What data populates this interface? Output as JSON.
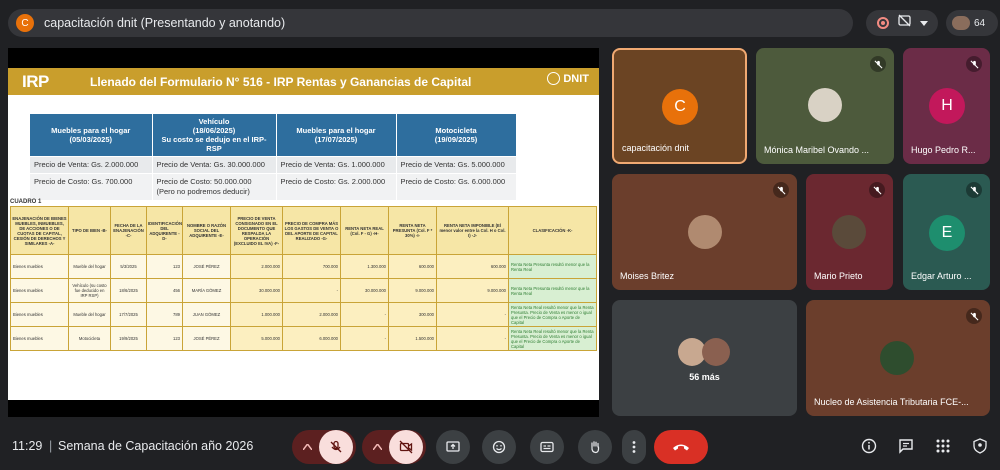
{
  "meeting": {
    "title_initial": "C",
    "title": "capacitación dnit (Presentando y anotando)",
    "participant_count": "64"
  },
  "slide": {
    "logo_text": "IRP",
    "title": "Llenado del Formulario N° 516 - IRP Rentas y Ganancias de Capital",
    "brand": "DNIT",
    "top_table": {
      "headers": [
        "Muebles para el hogar\n(05/03/2025)",
        "Vehículo\n(18/06/2025)\nSu costo se dedujo en el IRP-RSP",
        "Muebles para el hogar\n(17/07/2025)",
        "Motocicleta\n(19/09/2025)"
      ],
      "sale_row": [
        "Precio de Venta: Gs. 2.000.000",
        "Precio de Venta: Gs. 30.000.000",
        "Precio de Venta: Gs. 1.000.000",
        "Precio de Venta: Gs. 5.000.000"
      ],
      "cost_row": [
        "Precio de Costo: Gs. 700.000",
        "Precio de Costo: 50.000.000 (Pero no podremos deducir)",
        "Precio de Costo: Gs. 2.000.000",
        "Precio de Costo: Gs. 6.000.000"
      ]
    },
    "cuadro_label": "CUADRO 1",
    "main_table": {
      "headers": [
        "ENAJENACIÓN DE BIENES MUEBLES, INMUEBLES, DE ACCIONES O DE CUOTAS DE CAPITAL, CESIÓN DE DERECHOS Y SIMILARES -A-",
        "TIPO DE BIEN -B-",
        "FECHA DE LA ENAJENACIÓN -C-",
        "IDENTIFICACIÓN DEL ADQUIRENTE -D-",
        "NOMBRE O RAZÓN SOCIAL DEL ADQUIRENTE -E-",
        "PRECIO DE VENTA CONSIGNADO EN EL DOCUMENTO QUE RESPALDA LA OPERACIÓN (EXCLUIDO EL IVA) -F-",
        "PRECIO DE COMPRA MÁS LOS GASTOS DE VENTA O DEL APORTE DE CAPITAL REALIZADO -G-",
        "RENTA NETA REAL (Col. F - G) -H-",
        "RENTA NETA PRESUNTA (Col. F * 30%) -I-",
        "RENTA NETA IMPONIBLE (El menor valor entre la Col. H o Col. I) -J-",
        "CLASIFICACIÓN -K-"
      ],
      "rows": [
        [
          "Bienes muebles",
          "Mueble del hogar",
          "5/3/2025",
          "123",
          "JOSÉ PÉREZ",
          "2.000.000",
          "700.000",
          "1.300.000",
          "600.000",
          "600.000",
          "Renta Neta Presunta resultó menor que la Renta Real"
        ],
        [
          "Bienes muebles",
          "Vehículo (su costo fue deducido en IRP RSP)",
          "18/6/2025",
          "456",
          "MARÍA GÓMEZ",
          "30.000.000",
          "-",
          "30.000.000",
          "9.000.000",
          "9.000.000",
          "Renta Neta Presunta resultó menor que la Renta Real"
        ],
        [
          "Bienes muebles",
          "Mueble del hogar",
          "17/7/2025",
          "789",
          "JUAN GÓMEZ",
          "1.000.000",
          "2.000.000",
          "-",
          "300.000",
          "-",
          "Renta Neta Real resultó menor que la Renta Presunta. Precio de Venta es menor o igual que el Precio de Compra o Aporte de Capital"
        ],
        [
          "Bienes muebles",
          "Motocicleta",
          "19/9/2025",
          "123",
          "JOSÉ PÉREZ",
          "5.000.000",
          "6.000.000",
          "-",
          "1.500.000",
          "-",
          "Renta Neta Real resultó menor que la Renta Presunta. Precio de Venta es menor o igual que el Precio de Compra o Aporte de Capital"
        ]
      ]
    }
  },
  "tiles": {
    "self": {
      "initial": "C",
      "name": "capacitación dnit"
    },
    "p1": {
      "name": "Mónica Maribel Ovando ..."
    },
    "p2": {
      "initial": "H",
      "name": "Hugo Pedro R..."
    },
    "p3": {
      "name": "Moises Britez"
    },
    "p4": {
      "name": "Mario Prieto"
    },
    "p5": {
      "initial": "E",
      "name": "Edgar Arturo ..."
    },
    "more": {
      "label": "56 más"
    },
    "p6": {
      "name": "Nucleo de Asistencia Tributaria FCE-..."
    }
  },
  "bottom": {
    "time": "11:29",
    "separator": "|",
    "meeting_name": "Semana de Capacitación año 2026"
  },
  "colors": {
    "background": "#202124",
    "slide_gold": "#c99e2c",
    "header_blue": "#2e6e9e",
    "end_call_red": "#d93025",
    "muted_red": "#f9dedc"
  }
}
